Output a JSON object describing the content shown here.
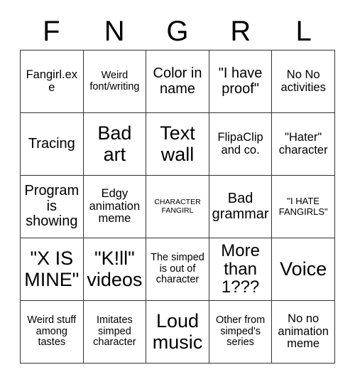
{
  "card": {
    "header_letters": [
      "F",
      "N",
      "G",
      "R",
      "L"
    ],
    "columns": 5,
    "rows": 5,
    "border_color": "#333333",
    "background_color": "#ffffff",
    "text_color": "#000000",
    "cells": [
      {
        "text": "Fangirl.exe",
        "size": "md"
      },
      {
        "text": "Weird font/writing",
        "size": "sm"
      },
      {
        "text": "Color in name",
        "size": "lg"
      },
      {
        "text": "\"I have proof\"",
        "size": "lg"
      },
      {
        "text": "No No activities",
        "size": "md"
      },
      {
        "text": "Tracing",
        "size": "lg"
      },
      {
        "text": "Bad art",
        "size": "xxl"
      },
      {
        "text": "Text wall",
        "size": "xxl"
      },
      {
        "text": "FlipaClip and co.",
        "size": "md"
      },
      {
        "text": "\"Hater\" character",
        "size": "md"
      },
      {
        "text": "Program is showing",
        "size": "lg"
      },
      {
        "text": "Edgy animation meme",
        "size": "md"
      },
      {
        "text": "CHARACTER FANGIRL",
        "size": "xxs"
      },
      {
        "text": "Bad grammar",
        "size": "lg"
      },
      {
        "text": "\"I HATE FANGIRLS\"",
        "size": "xs"
      },
      {
        "text": "\"X IS MINE\"",
        "size": "xxl"
      },
      {
        "text": "\"K!ll\" videos",
        "size": "xxl"
      },
      {
        "text": "The simped is out of character",
        "size": "sm"
      },
      {
        "text": "More than 1???",
        "size": "xl"
      },
      {
        "text": "Voice",
        "size": "xxl"
      },
      {
        "text": "Weird stuff among tastes",
        "size": "sm"
      },
      {
        "text": "Imitates simped character",
        "size": "sm"
      },
      {
        "text": "Loud music",
        "size": "xxl"
      },
      {
        "text": "Other from simped's series",
        "size": "sm"
      },
      {
        "text": "No no animation meme",
        "size": "md"
      }
    ]
  }
}
